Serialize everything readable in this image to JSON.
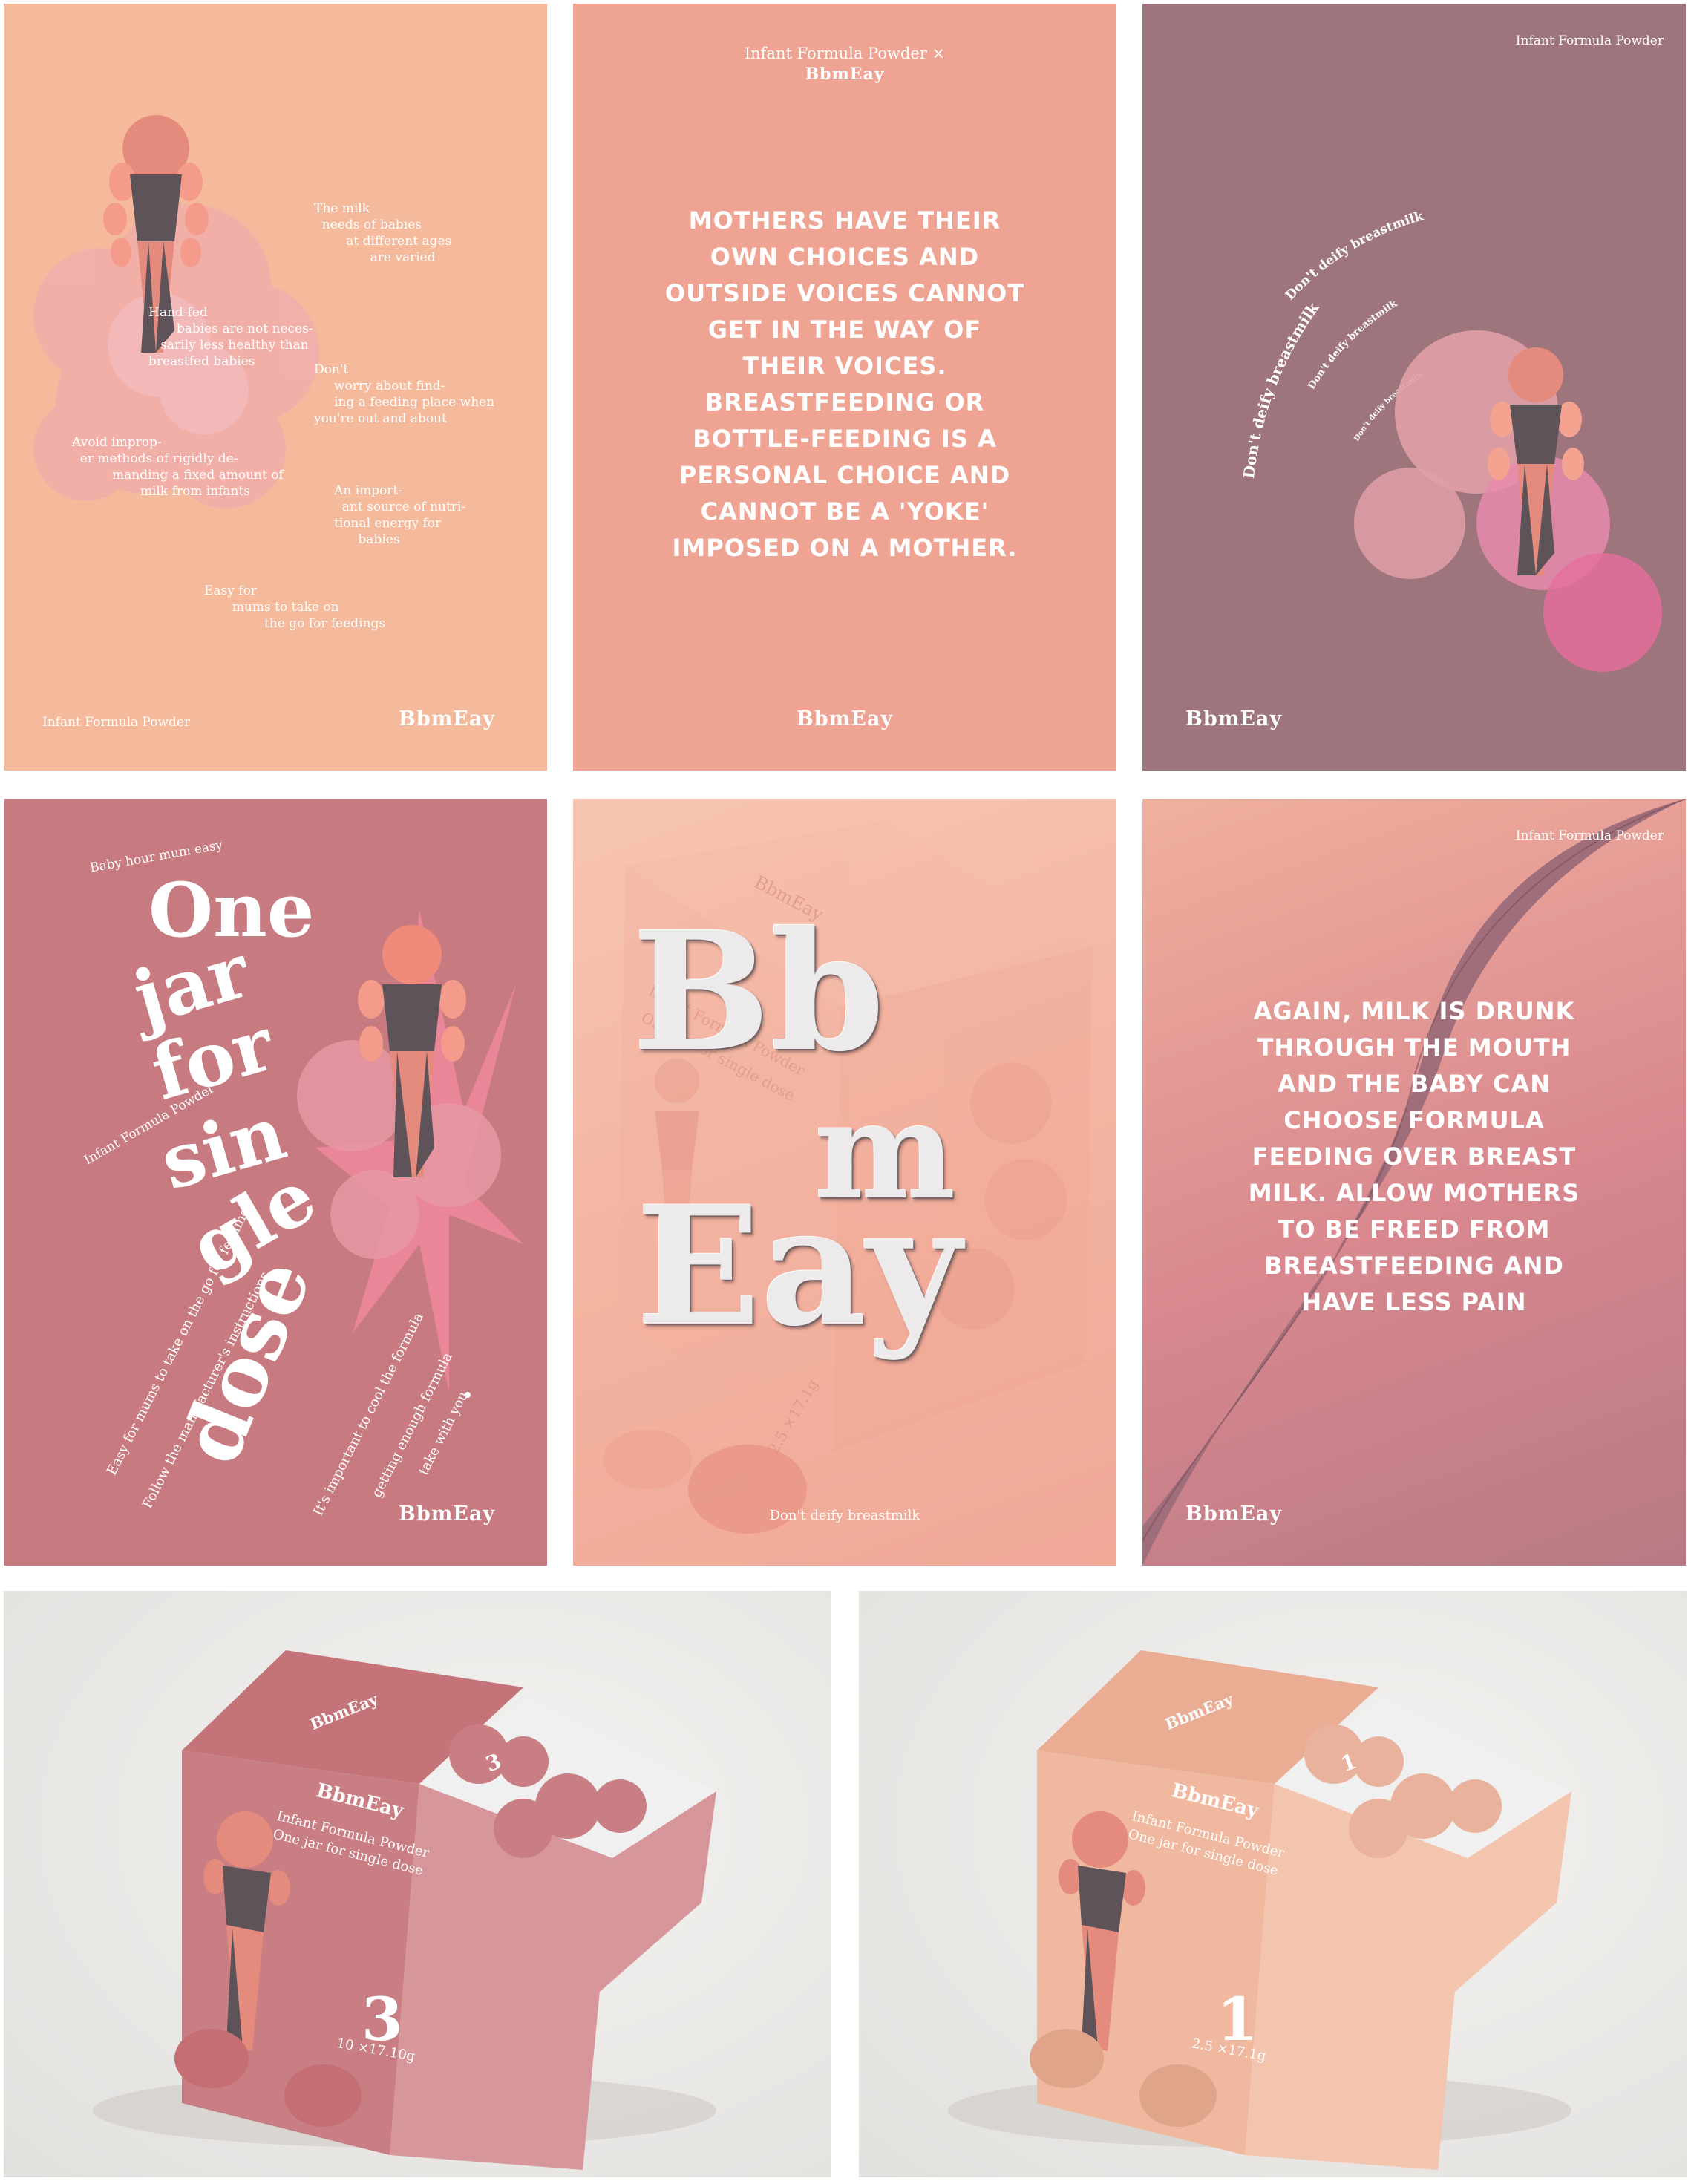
{
  "brand": "BbmEay",
  "colors": {
    "peach": "#f5b99b",
    "salmon": "#eea393",
    "mauve": "#9f757d",
    "rose": "#c77b80",
    "figure_dark": "#5d5358",
    "figure_head": "#e48b7d"
  },
  "poster1": {
    "fragments": [
      "The milk\n  needs of babies\n        at different ages\n              are varied",
      "Hand-fed\n       babies are not neces-\n   sarily less healthy than\nbreastfed babies",
      "Don't\n     worry about find-\n     ing a feeding place when\nyou're out and about",
      "Avoid improp-\n  er methods of rigidly de-\n          manding a fixed amount of\n                 milk from infants",
      "An import-\n  ant source of nutri-\ntional energy for\n      babies",
      "Easy for\n       mums to take on\n               the go for feedings"
    ],
    "footer_label": "Infant Formula Powder",
    "footer_brand": "BbmEay"
  },
  "poster2": {
    "header_line1": "Infant Formula Powder ×",
    "header_line2": "BbmEay",
    "quote": "Mothers have their own choices and outside voices cannot get in the way of their voices. Breastfeeding or bottle-feeding is a personal choice and cannot be a 'yoke' imposed on a mother.",
    "footer_brand": "BbmEay"
  },
  "poster3": {
    "header": "Infant Formula Powder",
    "arc_phrase": "Don't deify breastmilk",
    "footer_brand": "BbmEay"
  },
  "poster4": {
    "tagline": "Baby hour mum easy",
    "product": "Infant Formula Powder",
    "headline_words": [
      "One",
      "jar",
      "for",
      "sin",
      "gle",
      "dose"
    ],
    "diagonal_lines": [
      "Easy for mums to take on the go for feedings",
      "Follow the manufacturer's instructions",
      "It's important to cool the formula",
      "getting enough formula",
      "take with you"
    ],
    "footer_brand": "BbmEay"
  },
  "poster5": {
    "letters": [
      "Bb",
      "m",
      "Eay"
    ],
    "bg_brand": "BbmEay",
    "bg_product": "Infant Formula Powder",
    "bg_tagline": "One jar for single dose",
    "bg_weight": "2.5 ×17.1g",
    "footer": "Don't deify breastmilk"
  },
  "poster6": {
    "header": "Infant Formula Powder",
    "quote": "Again, milk is drunk through the mouth and the baby can choose formula feeding over breast milk. Allow mothers to be freed from breastfeeding and have less pain",
    "footer_brand": "BbmEay"
  },
  "box_left": {
    "brand_top": "BbmEay",
    "brand_front": "BbmEay",
    "product": "Infant Formula Powder",
    "tagline": "One jar for single dose",
    "number": "3",
    "weight": "10 ×17.10g",
    "pod_label": "3"
  },
  "box_right": {
    "brand_top": "BbmEay",
    "brand_front": "BbmEay",
    "product": "Infant Formula Powder",
    "tagline": "One jar for single dose",
    "number": "1",
    "weight": "2.5 ×17.1g",
    "pod_label": "1"
  }
}
